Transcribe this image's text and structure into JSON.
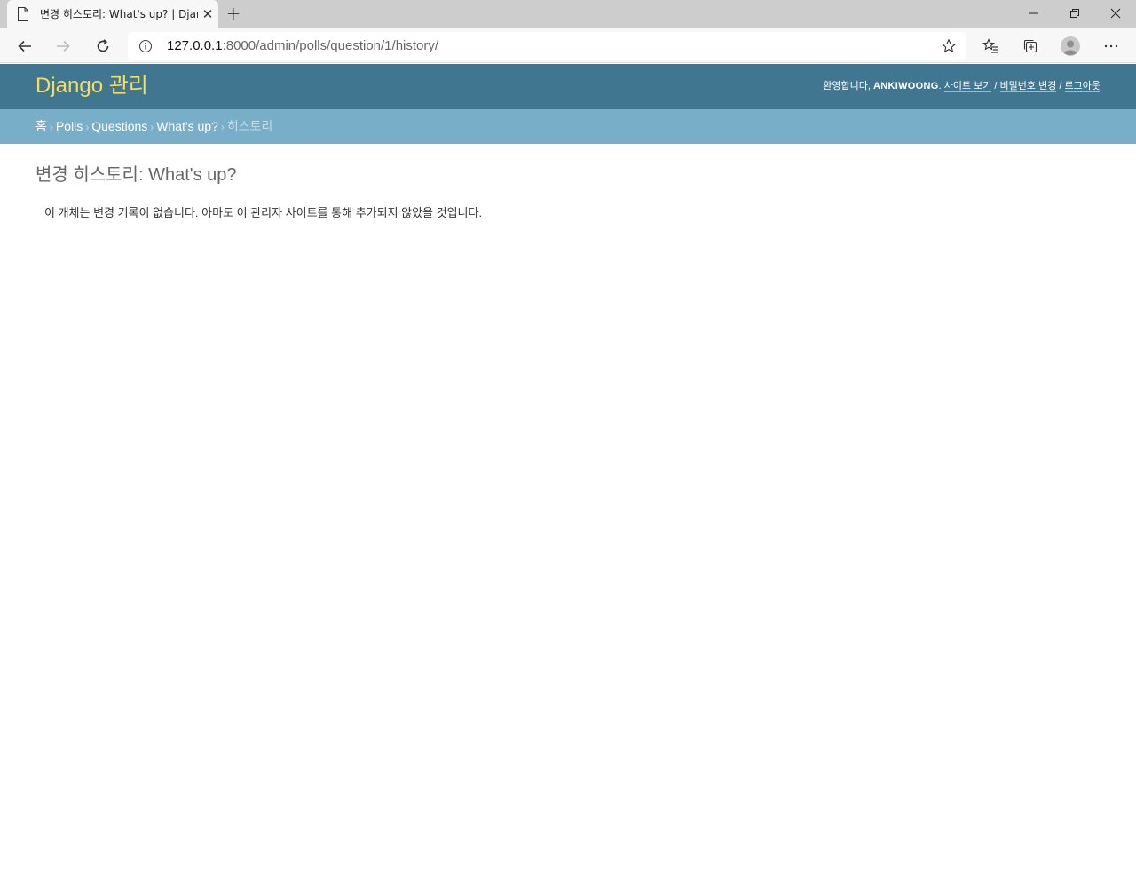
{
  "browser": {
    "tab_title": "변경 히스토리: What's up? | Django",
    "url_host": "127.0.0.1",
    "url_rest": ":8000/admin/polls/question/1/history/"
  },
  "admin": {
    "site_title": "Django 관리",
    "user_tools": {
      "welcome": "환영합니다,",
      "username": "ANKIWOONG",
      "period": ".",
      "view_site": "사이트 보기",
      "change_password": "비밀번호 변경",
      "logout": "로그아웃",
      "divider": "/"
    },
    "breadcrumbs": {
      "home": "홈",
      "app": "Polls",
      "model": "Questions",
      "object": "What's up?",
      "current": "히스토리",
      "separator": "›"
    },
    "page_title": "변경 히스토리: What's up?",
    "empty_message": "이 개체는 변경 기록이 없습니다. 아마도 이 관리자 사이트를 통해 추가되지 않았을 것입니다."
  },
  "icons": {
    "page": "page-icon",
    "close": "close-icon",
    "new_tab": "plus-icon",
    "back": "arrow-left-icon",
    "forward": "arrow-right-icon",
    "reload": "reload-icon",
    "info": "info-icon",
    "favorite": "star-icon",
    "favorites": "favorites-icon",
    "collections": "collections-icon",
    "profile": "profile-icon",
    "menu": "more-icon"
  }
}
